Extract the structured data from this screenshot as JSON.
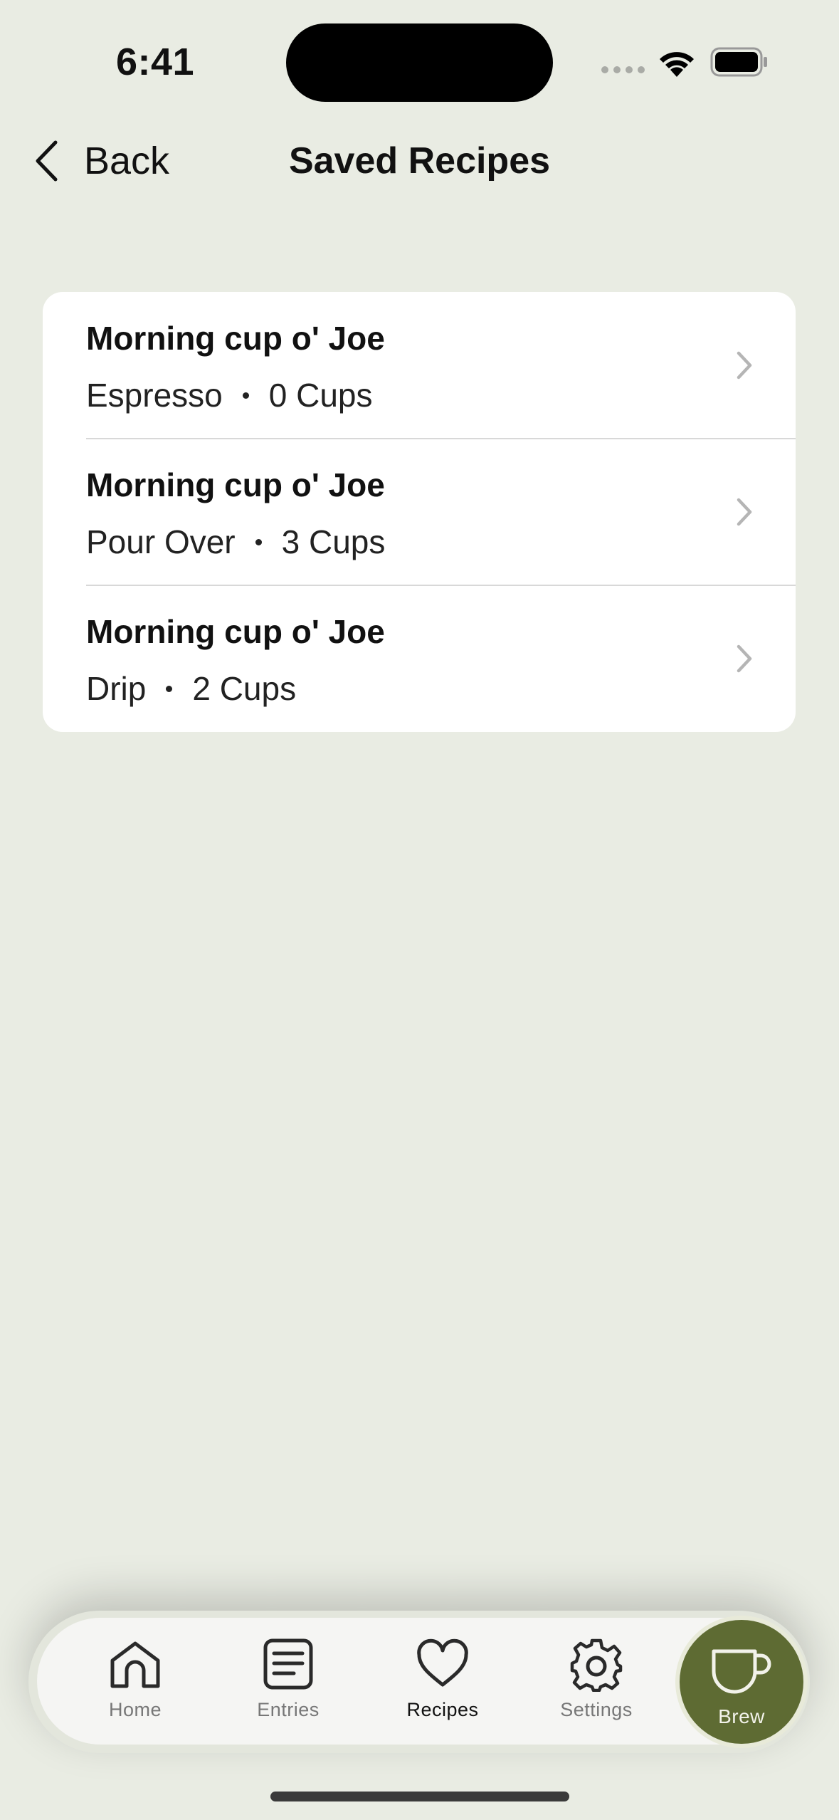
{
  "status_bar": {
    "time": "6:41"
  },
  "nav": {
    "back_label": "Back",
    "title": "Saved Recipes"
  },
  "recipes": [
    {
      "name": "Morning cup o' Joe",
      "method": "Espresso",
      "cups": "0 Cups"
    },
    {
      "name": "Morning cup o' Joe",
      "method": "Pour Over",
      "cups": "3 Cups"
    },
    {
      "name": "Morning cup o' Joe",
      "method": "Drip",
      "cups": "2 Cups"
    }
  ],
  "tabbar": {
    "tabs": [
      {
        "label": "Home",
        "icon": "home-icon",
        "active": false
      },
      {
        "label": "Entries",
        "icon": "entries-icon",
        "active": false
      },
      {
        "label": "Recipes",
        "icon": "heart-icon",
        "active": true
      },
      {
        "label": "Settings",
        "icon": "gear-icon",
        "active": false
      }
    ],
    "brew_label": "Brew",
    "brew_icon": "cup-icon",
    "brew_color": "#5e6b33"
  },
  "colors": {
    "background": "#e9ece3",
    "card": "#ffffff",
    "accent": "#5e6b33"
  }
}
